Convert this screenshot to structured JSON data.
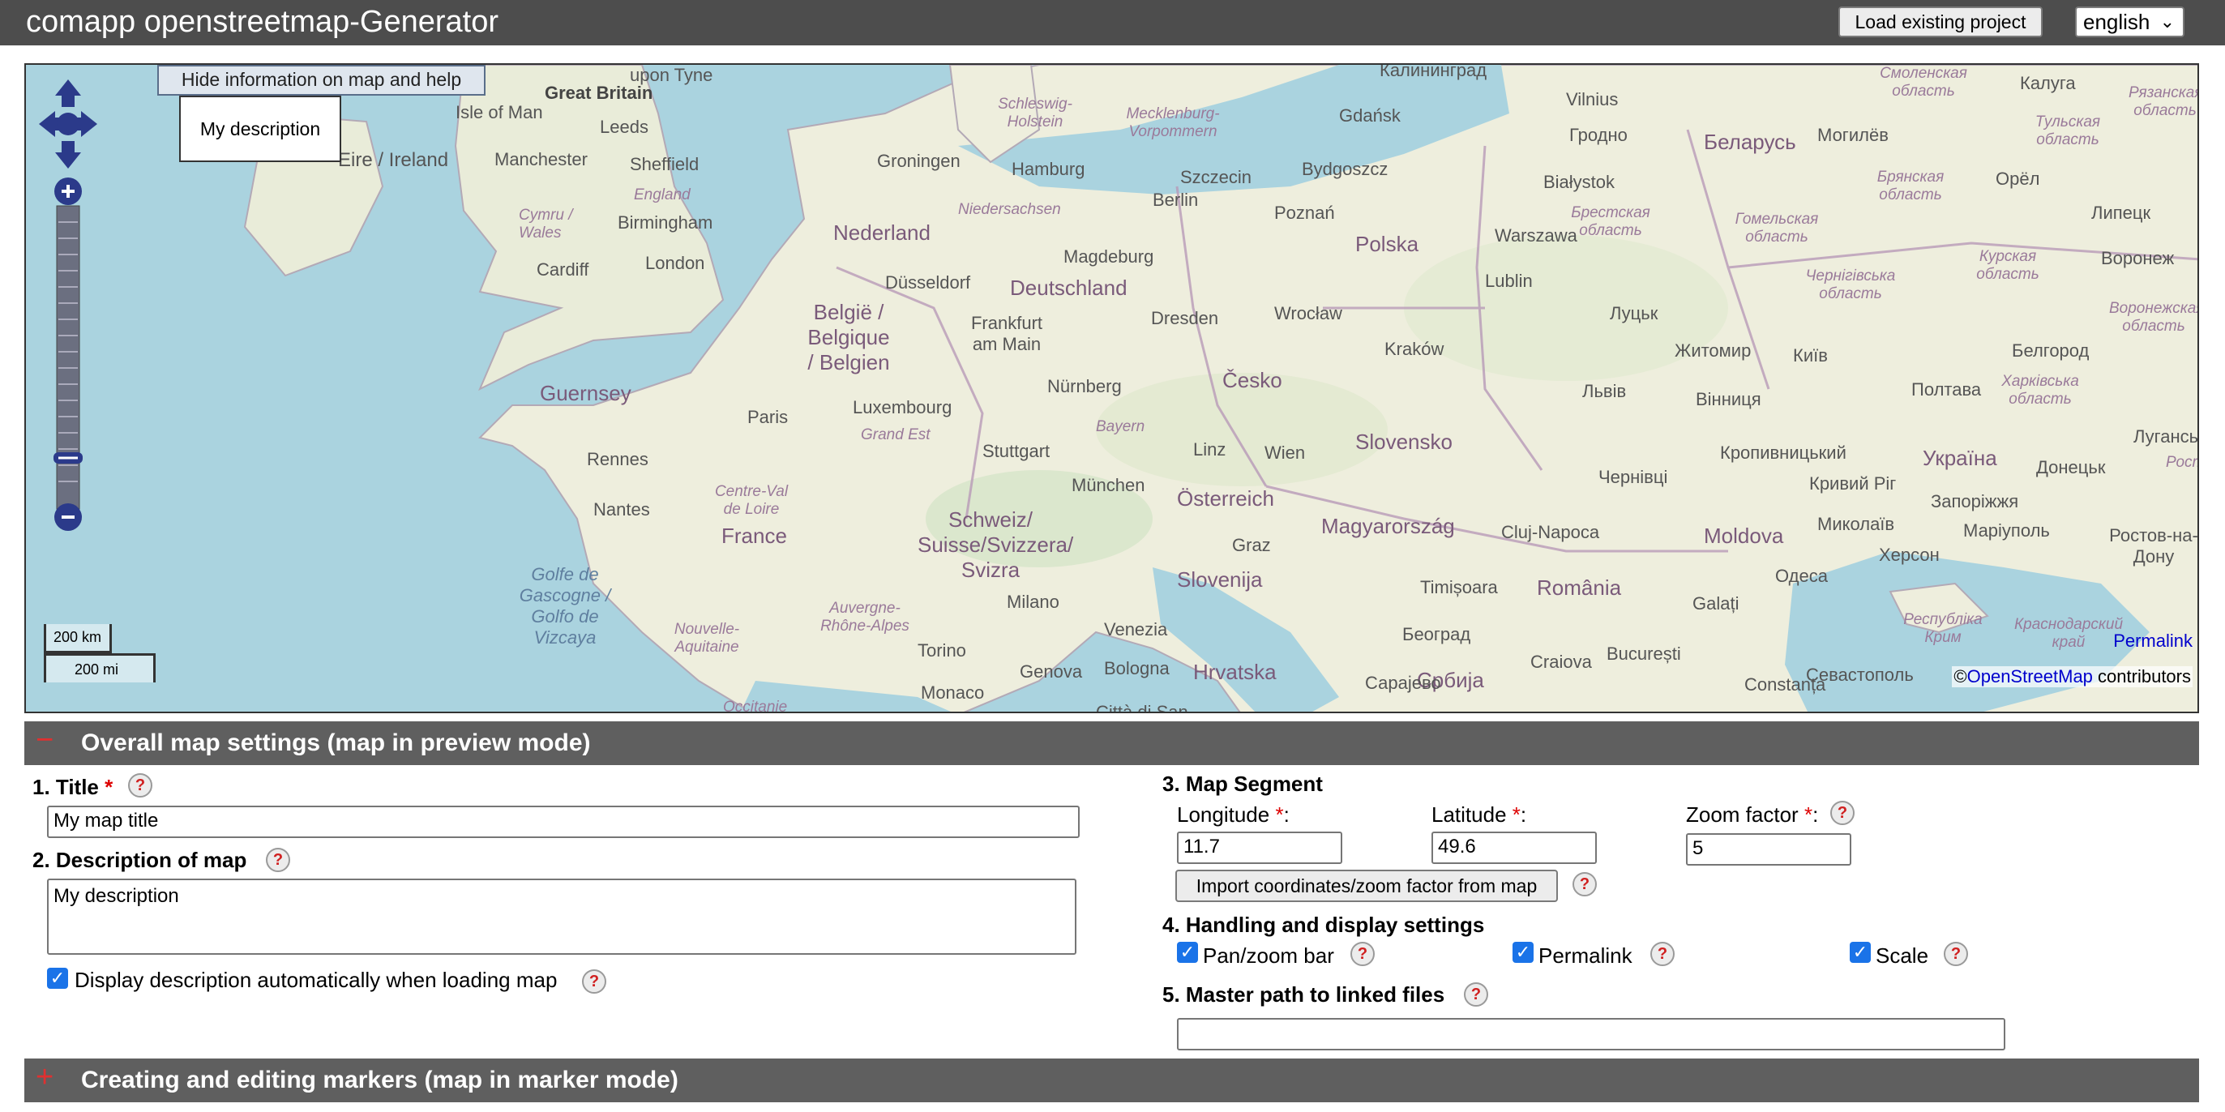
{
  "app": {
    "title": "comapp openstreetmap-Generator",
    "load_button": "Load existing project",
    "language": "english"
  },
  "map": {
    "hide_info_button": "Hide information on map and help",
    "description_popup": "My description",
    "scale_km": "200 km",
    "scale_mi": "200 mi",
    "permalink": "Permalink",
    "attribution_prefix": "©",
    "attribution_link": "OpenStreetMap",
    "attribution_suffix": "contributors",
    "labels": {
      "great_britain": "Great Britain",
      "isle_of_man": "Isle of Man",
      "ireland": "Eire / Ireland",
      "leeds": "Leeds",
      "upon_tyne": "upon Tyne",
      "sheffield": "Sheffield",
      "manchester": "Manchester",
      "england": "England",
      "birmingham": "Birmingham",
      "cymru": "Cymru / Wales",
      "cardiff": "Cardiff",
      "london": "London",
      "guernsey": "Guernsey",
      "rennes": "Rennes",
      "nantes": "Nantes",
      "paris": "Paris",
      "france": "France",
      "centre": "Centre-Val de Loire",
      "golfe": "Golfe de Gascogne / Golfo de Vizcaya",
      "nouvelle": "Nouvelle-Aquitaine",
      "auvergne": "Auvergne-Rhône-Alpes",
      "occitanie": "Occitanie",
      "groningen": "Groningen",
      "nederland": "Nederland",
      "belgie": "België / Belgique / Belgien",
      "luxembourg": "Luxembourg",
      "grand_est": "Grand Est",
      "dusseldorf": "Düsseldorf",
      "frankfurt": "Frankfurt am Main",
      "deutschland": "Deutschland",
      "hamburg": "Hamburg",
      "schleswig": "Schleswig-Holstein",
      "niedersachsen": "Niedersachsen",
      "mecklenburg": "Mecklenburg-Vorpommern",
      "berlin": "Berlin",
      "magdeburg": "Magdeburg",
      "dresden": "Dresden",
      "nurnberg": "Nürnberg",
      "bayern": "Bayern",
      "stuttgart": "Stuttgart",
      "munchen": "München",
      "schweiz": "Schweiz/ Suisse/Svizzera/ Svizra",
      "milano": "Milano",
      "torino": "Torino",
      "genova": "Genova",
      "bologna": "Bologna",
      "venezia": "Venezia",
      "monaco": "Monaco",
      "citta": "Città di San",
      "osterreich": "Österreich",
      "linz": "Linz",
      "wien": "Wien",
      "graz": "Graz",
      "slovenija": "Slovenija",
      "hrvatska": "Hrvatska",
      "szczecin": "Szczecin",
      "poznan": "Poznań",
      "polska": "Polska",
      "gdansk": "Gdańsk",
      "bydgoszcz": "Bydgoszcz",
      "warszawa": "Warszawa",
      "wroclaw": "Wrocław",
      "krakow": "Kraków",
      "lublin": "Lublin",
      "cesko": "Česko",
      "slovensko": "Slovensko",
      "magyarorszag": "Magyarország",
      "cluj": "Cluj-Napoca",
      "timisoara": "Timișoara",
      "romania": "România",
      "beograd": "Београд",
      "srbija": "Србија",
      "sarajevo": "Сарајево",
      "craiova": "Craiova",
      "bucuresti": "București",
      "constanta": "Constanța",
      "galati": "Galați",
      "moldova": "Moldova",
      "kaliningrad": "Калининград",
      "vilnius": "Vilnius",
      "grodno": "Гродно",
      "belarus": "Беларусь",
      "mogilev": "Могилёв",
      "bialystok": "Białystok",
      "brest": "Брестская область",
      "gomel": "Гомельская область",
      "smolensk": "Смоленская область",
      "kaluga": "Калуга",
      "ryazan": "Рязанская область",
      "tula": "Тульская область",
      "bryansk": "Брянская область",
      "orel": "Орёл",
      "lipetsk": "Липецк",
      "kursk": "Курская область",
      "voronezh": "Воронеж",
      "voronezh_obl": "Воронежская область",
      "belgorod": "Белгород",
      "chernihiv": "Чернігівська область",
      "kyiv": "Київ",
      "lutsk": "Луцьк",
      "zhytomyr": "Житомир",
      "lviv": "Львів",
      "vinnytsia": "Вінниця",
      "poltava": "Полтава",
      "kharkiv": "Харківська область",
      "luhansk": "Луганськ",
      "kropyvnytskyi": "Кропивницький",
      "ukraina": "Україна",
      "donetsk": "Донецьк",
      "rostov_obl": "Ростов",
      "chernivtsi": "Чернівці",
      "kryvyi": "Кривий Ріг",
      "zaporizhzhia": "Запоріжжя",
      "mykolaiv": "Миколаїв",
      "mariupol": "Маріуполь",
      "rostov": "Ростов-на-Дону",
      "odesa": "Одеса",
      "kherson": "Херсон",
      "krym": "Республіка Крим",
      "krasnodar": "Краснодарский край",
      "sevastopol": "Севастополь"
    }
  },
  "sections": {
    "overall": {
      "symbol": "−",
      "title": "Overall map settings (map in preview mode)"
    },
    "markers": {
      "symbol": "+",
      "title": "Creating and editing markers (map in marker mode)"
    }
  },
  "form": {
    "title_label": "1. Title",
    "title_value": "My map title",
    "description_label": "2. Description of map",
    "description_value": "My description",
    "display_desc_label": "Display description automatically when loading map",
    "segment_label": "3. Map Segment",
    "longitude_label": "Longitude",
    "longitude_value": "11.7",
    "latitude_label": "Latitude",
    "latitude_value": "49.6",
    "zoom_label": "Zoom factor",
    "zoom_value": "5",
    "import_button": "Import coordinates/zoom factor from map",
    "handling_label": "4. Handling and display settings",
    "pan_zoom_label": "Pan/zoom bar",
    "permalink_label": "Permalink",
    "scale_label": "Scale",
    "master_path_label": "5. Master path to linked files",
    "master_path_value": "",
    "required_mark": "*",
    "colon": ":",
    "help_glyph": "?",
    "check_glyph": "✓"
  }
}
